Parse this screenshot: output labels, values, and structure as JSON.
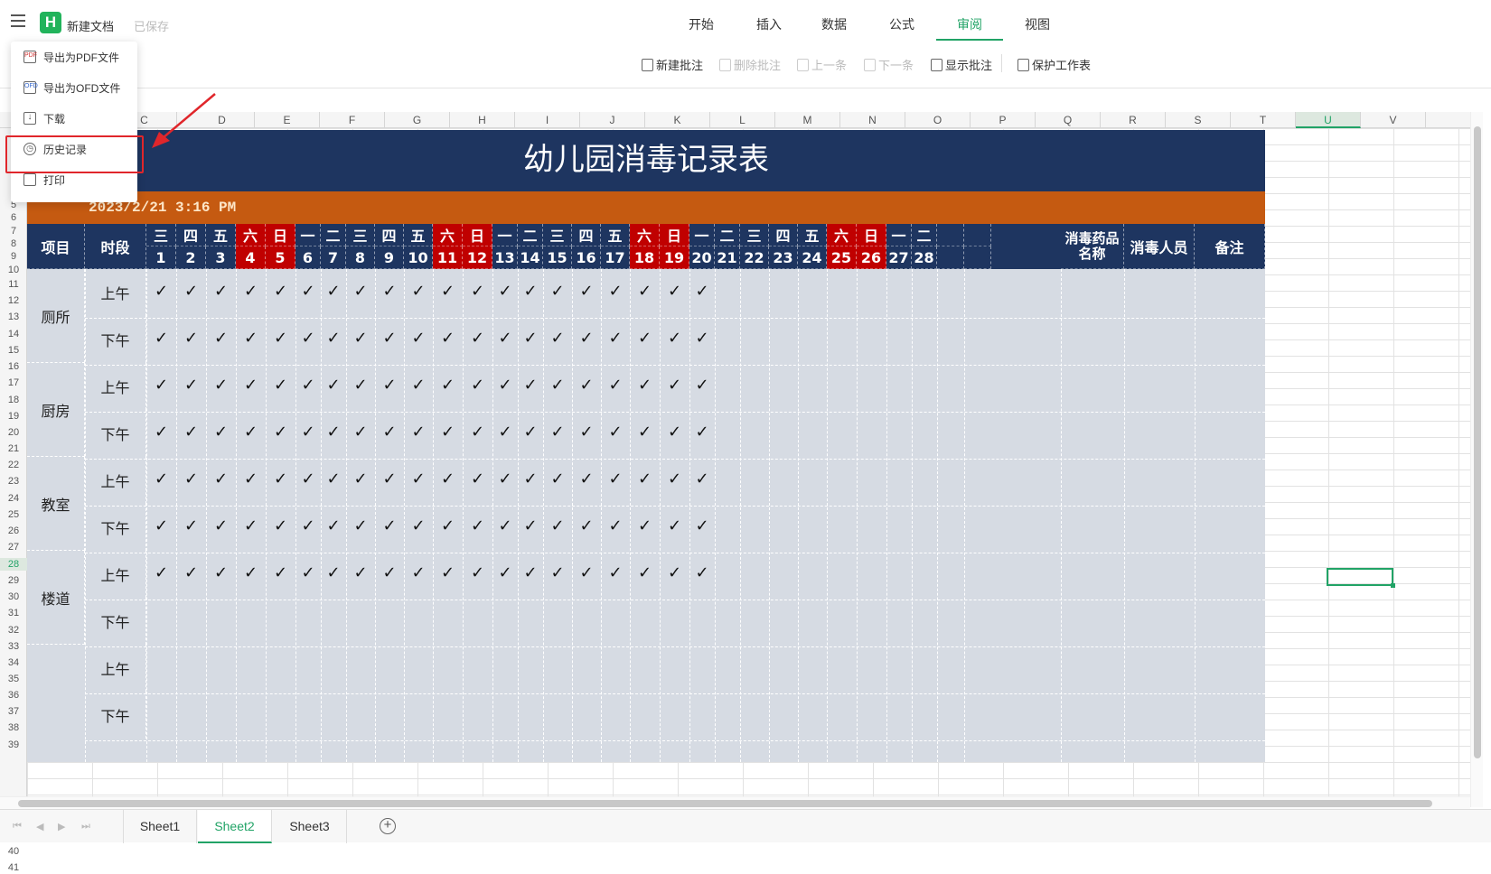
{
  "app": {
    "title": "新建文档",
    "save_status": "已保存",
    "logo_letter": "H",
    "accent": "#21a366",
    "brand": "#21b35b"
  },
  "tabs": [
    {
      "label": "开始"
    },
    {
      "label": "插入"
    },
    {
      "label": "数据"
    },
    {
      "label": "公式"
    },
    {
      "label": "审阅",
      "active": true
    },
    {
      "label": "视图"
    }
  ],
  "toolbar": {
    "new_comment": "新建批注",
    "delete_comment": "删除批注",
    "prev": "上一条",
    "next": "下一条",
    "show_comments": "显示批注",
    "protect_sheet": "保护工作表"
  },
  "menu": {
    "items": [
      {
        "label": "导出为PDF文件",
        "icon": "pdf-icon",
        "icon_text": "PDF"
      },
      {
        "label": "导出为OFD文件",
        "icon": "ofd-icon",
        "icon_text": "OFD"
      },
      {
        "label": "下载",
        "icon": "download-icon"
      },
      {
        "label": "历史记录",
        "icon": "history-icon"
      },
      {
        "label": "打印",
        "icon": "print-icon"
      }
    ]
  },
  "columns": [
    "C",
    "D",
    "E",
    "F",
    "G",
    "H",
    "I",
    "J",
    "K",
    "L",
    "M",
    "N",
    "O",
    "P",
    "Q",
    "R",
    "S",
    "T",
    "U",
    "V"
  ],
  "selected_column": "U",
  "rows": [
    "5",
    "6",
    "7",
    "8",
    "9",
    "10",
    "11",
    "12",
    "13",
    "14",
    "15",
    "16",
    "17",
    "18",
    "19",
    "20",
    "21",
    "22",
    "23",
    "24",
    "25",
    "26",
    "27",
    "28",
    "29",
    "30",
    "31",
    "32",
    "33",
    "34",
    "35",
    "36",
    "37",
    "38",
    "39",
    "40",
    "41"
  ],
  "selected_row": "28",
  "sheet": {
    "title": "幼儿园消毒记录表",
    "datetime": "2023/2/21 3:16 PM",
    "col_item": "项目",
    "col_period": "时段",
    "col_chem": "消毒药品名称",
    "col_staff": "消毒人员",
    "col_note": "备注",
    "weekdays": [
      "三",
      "四",
      "五",
      "六",
      "日",
      "一",
      "二",
      "三",
      "四",
      "五",
      "六",
      "日",
      "一",
      "二",
      "三",
      "四",
      "五",
      "六",
      "日",
      "一",
      "二",
      "三",
      "四",
      "五",
      "六",
      "日",
      "一",
      "二",
      "",
      ""
    ],
    "days": [
      "1",
      "2",
      "3",
      "4",
      "5",
      "6",
      "7",
      "8",
      "9",
      "10",
      "11",
      "12",
      "13",
      "14",
      "15",
      "16",
      "17",
      "18",
      "19",
      "20",
      "21",
      "22",
      "23",
      "24",
      "25",
      "26",
      "27",
      "28",
      "",
      ""
    ],
    "weekend_indices": [
      3,
      4,
      10,
      11,
      17,
      18,
      24,
      25
    ],
    "categories": [
      {
        "label": "厕所",
        "periods": [
          "上午",
          "下午"
        ],
        "checks": [
          20,
          20
        ]
      },
      {
        "label": "厨房",
        "periods": [
          "上午",
          "下午"
        ],
        "checks": [
          20,
          20
        ]
      },
      {
        "label": "教室",
        "periods": [
          "上午",
          "下午"
        ],
        "checks": [
          20,
          20
        ]
      },
      {
        "label": "楼道",
        "periods": [
          "上午",
          "下午",
          "上午",
          "下午"
        ],
        "checks": [
          20,
          0,
          0,
          0
        ]
      }
    ],
    "check_mark": "✓"
  },
  "sheet_tabs": [
    {
      "label": "Sheet1"
    },
    {
      "label": "Sheet2",
      "active": true
    },
    {
      "label": "Sheet3"
    }
  ],
  "colors": {
    "header_navy": "#1e3560",
    "date_orange": "#c55a11",
    "weekend_red": "#c00000",
    "body_grey": "#d6dbe3",
    "highlight_red": "#e0262b"
  }
}
